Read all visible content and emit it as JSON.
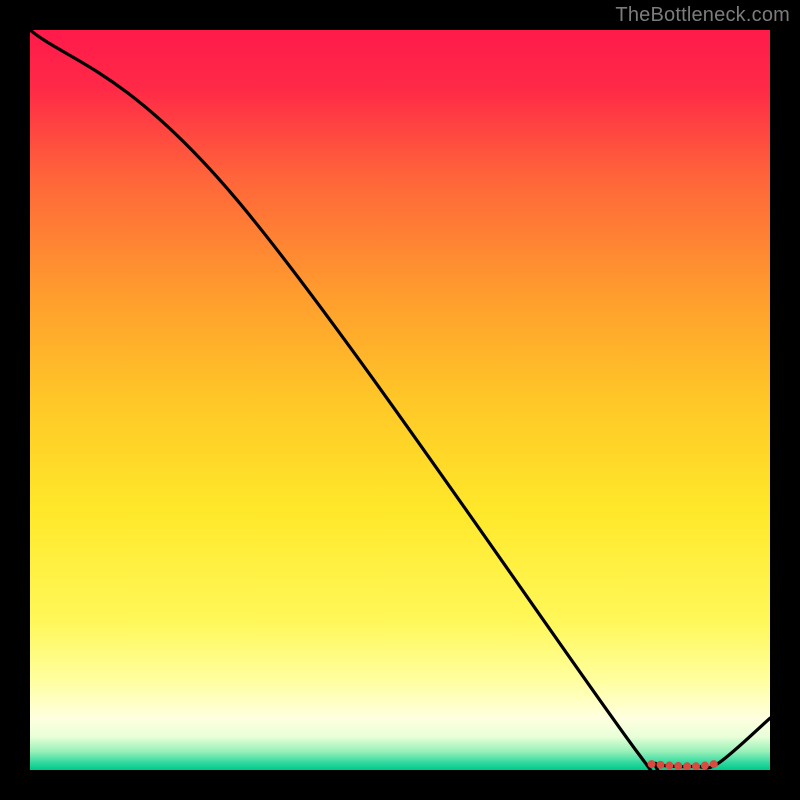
{
  "attribution": "TheBottleneck.com",
  "chart_data": {
    "type": "line",
    "title": "",
    "xlabel": "",
    "ylabel": "",
    "xlim": [
      0,
      100
    ],
    "ylim": [
      0,
      100
    ],
    "series": [
      {
        "name": "curve",
        "x": [
          0,
          28.0,
          82.0,
          84.5,
          87.0,
          90.0,
          93.0,
          100.0
        ],
        "y": [
          100,
          77.0,
          2.5,
          0.9,
          0.5,
          0.5,
          0.9,
          7.0
        ]
      }
    ],
    "markers": {
      "name": "highlight-points",
      "x": [
        84.0,
        85.2,
        86.4,
        87.6,
        88.8,
        90.0,
        91.2,
        92.4
      ],
      "y": [
        0.8,
        0.7,
        0.6,
        0.55,
        0.5,
        0.5,
        0.6,
        0.8
      ],
      "color": "#d94a3f",
      "radius": 4
    },
    "background_gradient_stops": [
      {
        "offset": 0.0,
        "color": "#ff1a4b"
      },
      {
        "offset": 0.08,
        "color": "#ff2a47"
      },
      {
        "offset": 0.2,
        "color": "#ff653a"
      },
      {
        "offset": 0.35,
        "color": "#ff9a2e"
      },
      {
        "offset": 0.5,
        "color": "#ffc727"
      },
      {
        "offset": 0.65,
        "color": "#ffe82a"
      },
      {
        "offset": 0.8,
        "color": "#fff85a"
      },
      {
        "offset": 0.88,
        "color": "#ffffa0"
      },
      {
        "offset": 0.93,
        "color": "#ffffe0"
      },
      {
        "offset": 0.955,
        "color": "#e8ffd8"
      },
      {
        "offset": 0.975,
        "color": "#98f0b8"
      },
      {
        "offset": 0.99,
        "color": "#30d9a0"
      },
      {
        "offset": 1.0,
        "color": "#00c98a"
      }
    ]
  }
}
